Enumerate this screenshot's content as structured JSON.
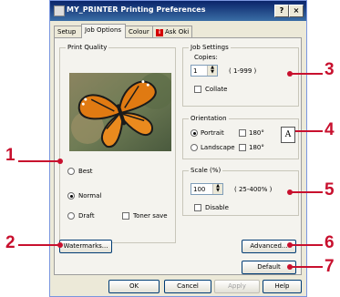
{
  "window": {
    "title": "MY_PRINTER Printing Preferences",
    "help_btn": "?",
    "close_btn": "×"
  },
  "tabs": [
    {
      "label": "Setup"
    },
    {
      "label": "Job Options"
    },
    {
      "label": "Colour"
    },
    {
      "label": "Ask Oki"
    }
  ],
  "print_quality": {
    "group_label": "Print Quality",
    "best": "Best",
    "normal": "Normal",
    "draft": "Draft",
    "toner_save": "Toner save"
  },
  "job_settings": {
    "group_label": "Job Settings",
    "copies_label": "Copies:",
    "copies_value": "1",
    "copies_range": "( 1-999 )",
    "collate": "Collate"
  },
  "orientation": {
    "group_label": "Orientation",
    "portrait": "Portrait",
    "landscape": "Landscape",
    "rot1": "180°",
    "rot2": "180°",
    "preview_letter": "A"
  },
  "scale": {
    "group_label": "Scale (%)",
    "value": "100",
    "range": "( 25-400% )",
    "disable": "Disable"
  },
  "buttons": {
    "watermarks": "Watermarks...",
    "advanced": "Advanced...",
    "default": "Default",
    "ok": "OK",
    "cancel": "Cancel",
    "apply": "Apply",
    "help": "Help"
  },
  "callouts": [
    "1",
    "2",
    "3",
    "4",
    "5",
    "6",
    "7"
  ],
  "colors": {
    "callout": "#c8102e",
    "titlebar": "#0a246a"
  }
}
